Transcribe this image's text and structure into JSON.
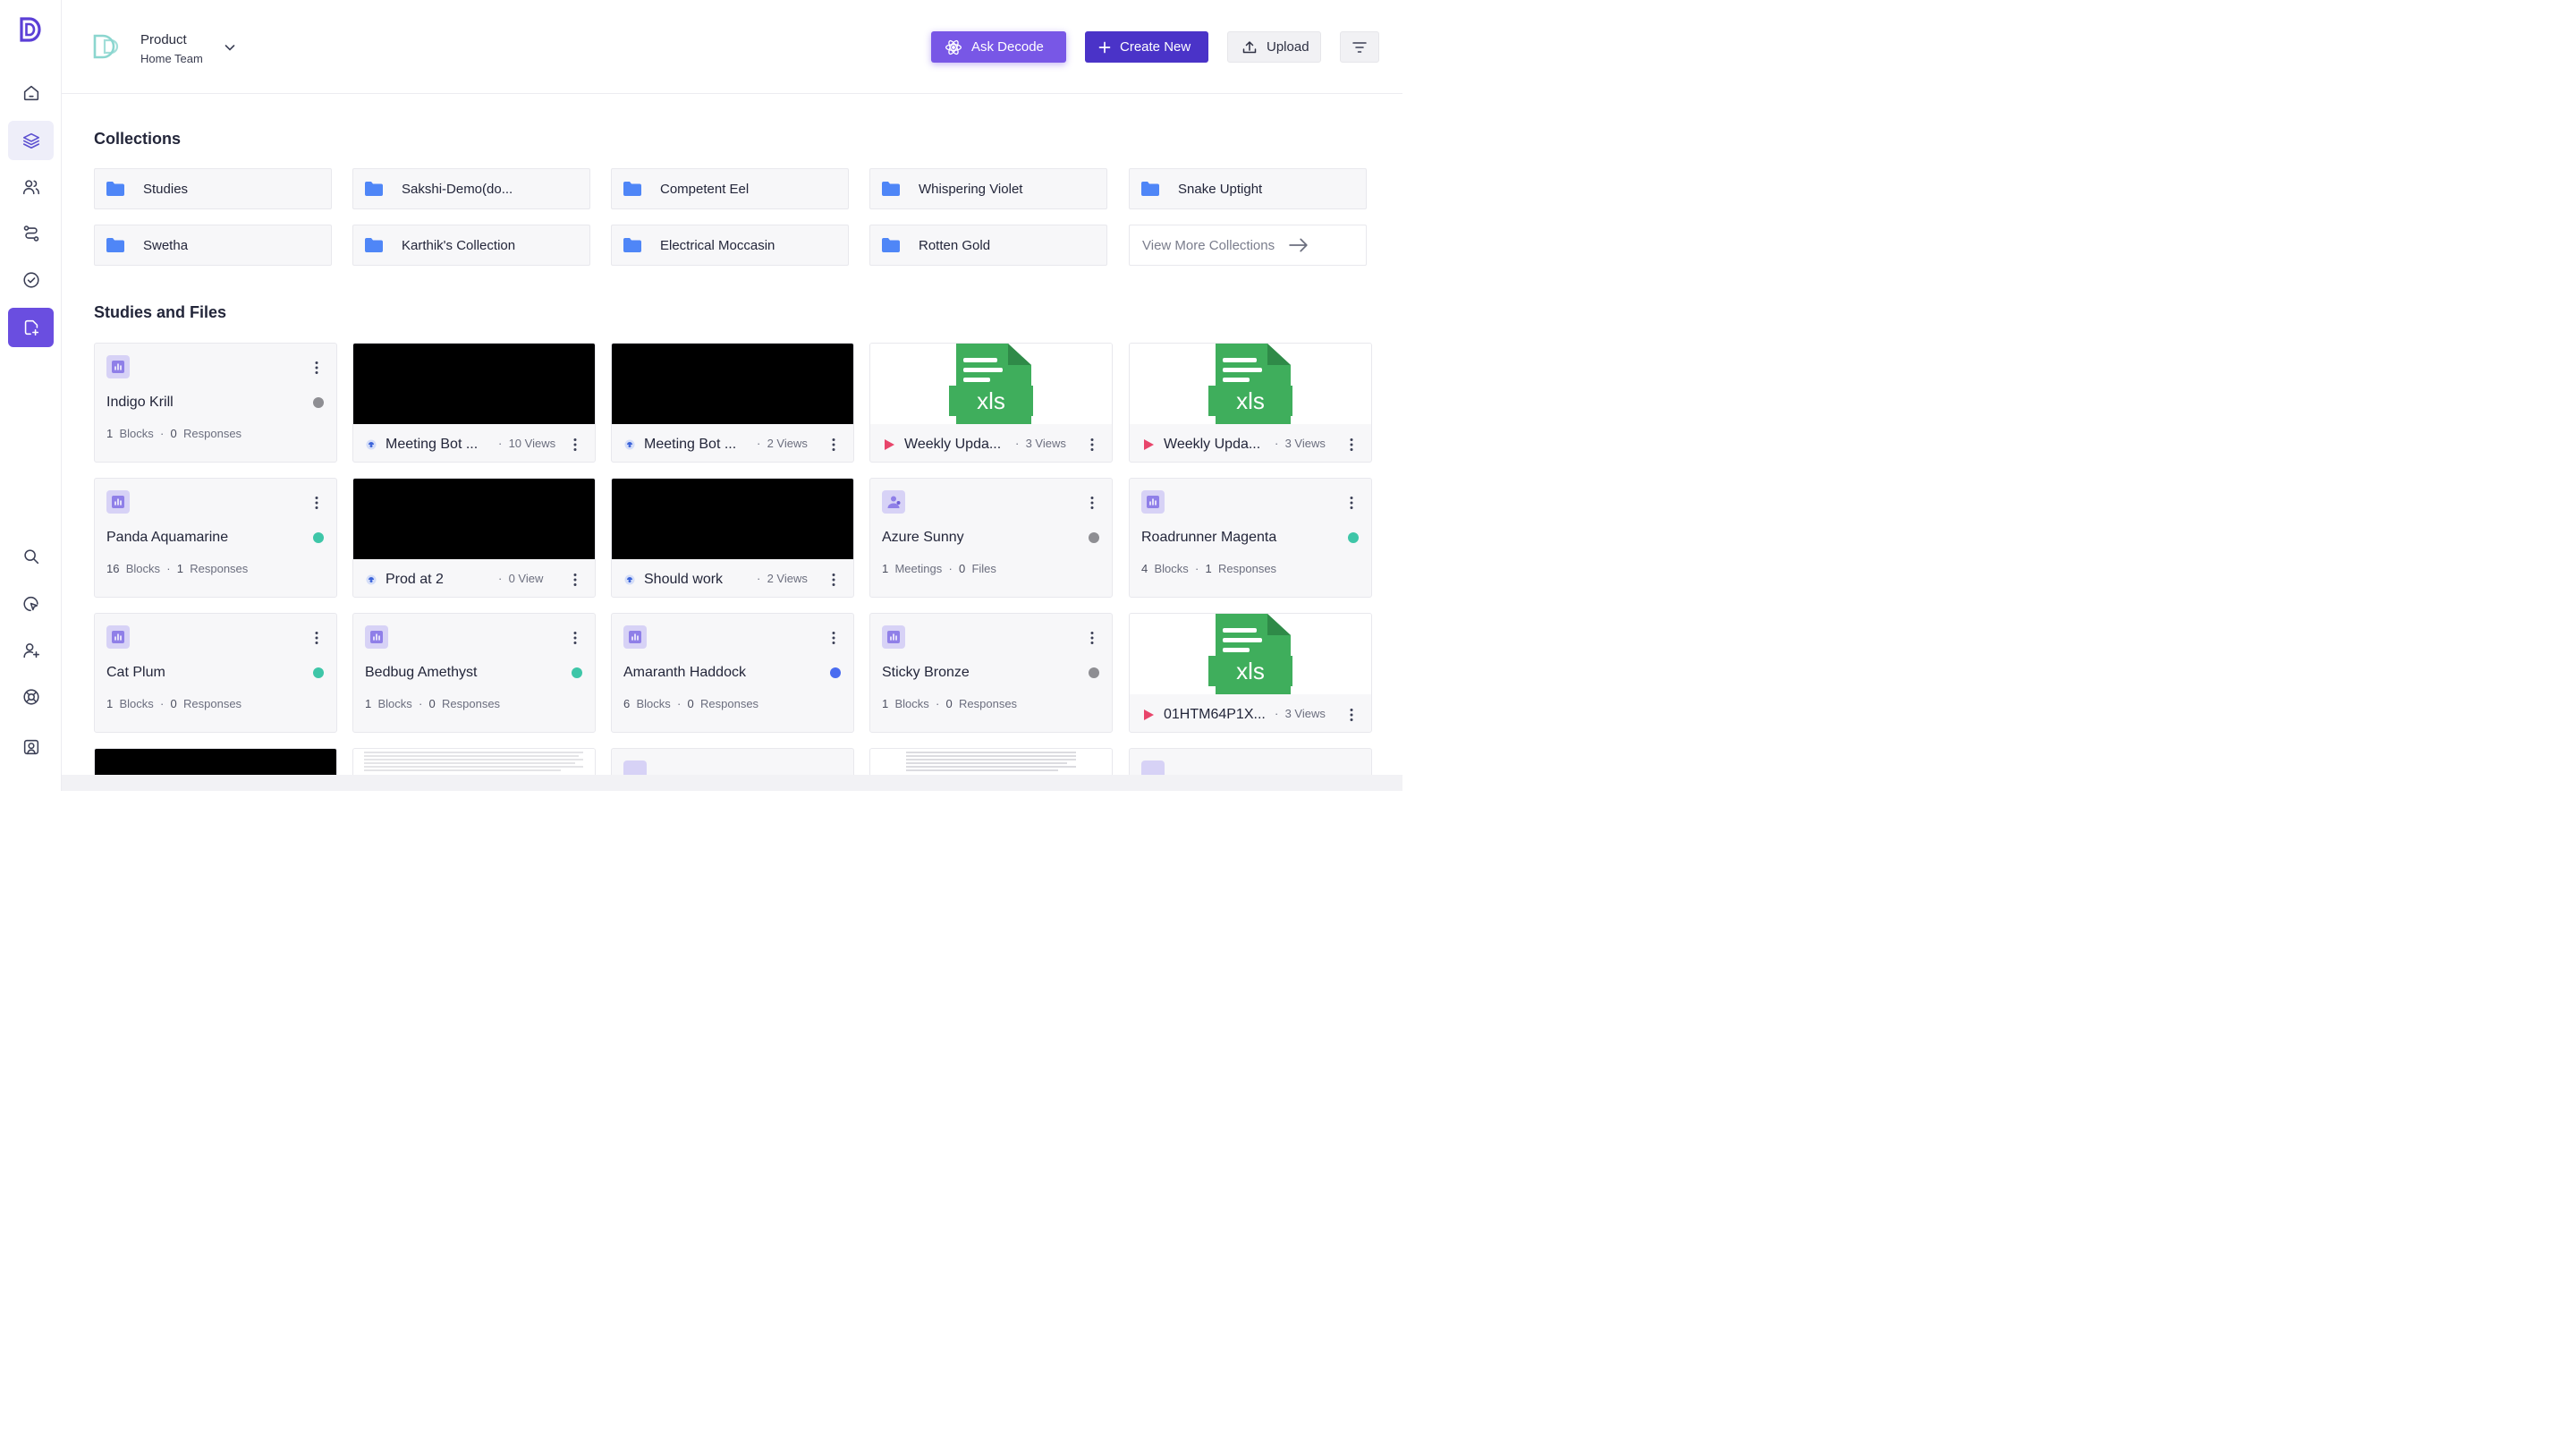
{
  "workspace": {
    "name": "Product",
    "team": "Home Team"
  },
  "header": {
    "ask_label": "Ask Decode",
    "create_label": "Create New",
    "upload_label": "Upload"
  },
  "collections": {
    "title": "Collections",
    "items": [
      "Studies",
      "Sakshi-Demo(do...",
      "Competent Eel",
      "Whispering Violet",
      "Snake Uptight",
      "Swetha",
      "Karthik's Collection",
      "Electrical Moccasin",
      "Rotten Gold"
    ],
    "view_more": "View More Collections"
  },
  "studies": {
    "title": "Studies and Files",
    "cards": [
      {
        "title": "Indigo Krill",
        "n1": "1",
        "l1": "Blocks",
        "n2": "0",
        "l2": "Responses"
      },
      {
        "title": "Panda Aquamarine",
        "n1": "16",
        "l1": "Blocks",
        "n2": "1",
        "l2": "Responses"
      },
      {
        "title": "Azure Sunny",
        "n1": "1",
        "l1": "Meetings",
        "n2": "0",
        "l2": "Files"
      },
      {
        "title": "Roadrunner Magenta",
        "n1": "4",
        "l1": "Blocks",
        "n2": "1",
        "l2": "Responses"
      },
      {
        "title": "Cat Plum",
        "n1": "1",
        "l1": "Blocks",
        "n2": "0",
        "l2": "Responses"
      },
      {
        "title": "Bedbug Amethyst",
        "n1": "1",
        "l1": "Blocks",
        "n2": "0",
        "l2": "Responses"
      },
      {
        "title": "Amaranth Haddock",
        "n1": "6",
        "l1": "Blocks",
        "n2": "0",
        "l2": "Responses"
      },
      {
        "title": "Sticky Bronze",
        "n1": "1",
        "l1": "Blocks",
        "n2": "0",
        "l2": "Responses"
      }
    ],
    "media": [
      {
        "name": "Meeting Bot ...",
        "views": "10 Views"
      },
      {
        "name": "Meeting Bot ...",
        "views": "2 Views"
      },
      {
        "name": "Weekly Upda...",
        "views": "3 Views",
        "thumb_label": "xls"
      },
      {
        "name": "Weekly Upda...",
        "views": "3 Views",
        "thumb_label": "xls"
      },
      {
        "name": "Prod at 2",
        "views": "0 View"
      },
      {
        "name": "Should work",
        "views": "2 Views"
      },
      {
        "name": "01HTM64P1X...",
        "views": "3 Views",
        "thumb_label": "xls"
      }
    ]
  },
  "colors": {
    "accent": "#6a4ee0",
    "create": "#4a33c8",
    "status_gray": "#8e8e93",
    "status_teal": "#3ec6a8",
    "status_blue": "#4a6cf0",
    "folder": "#4f86f7"
  }
}
